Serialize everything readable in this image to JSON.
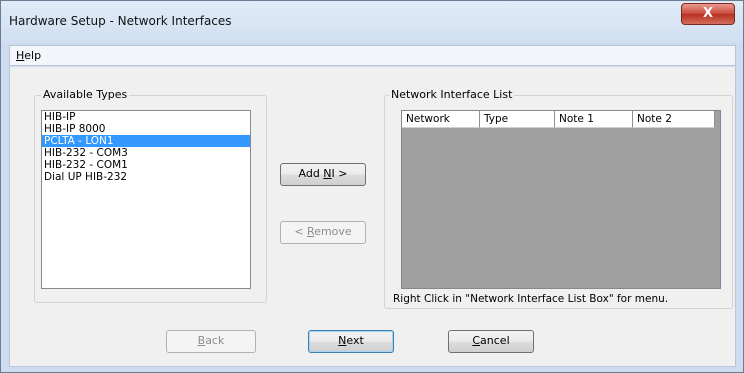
{
  "window": {
    "title": "Hardware Setup - Network Interfaces",
    "close_label": "X"
  },
  "menu": {
    "help": {
      "label_u": "H",
      "label_rest": "elp"
    }
  },
  "available_types": {
    "label": "Available Types",
    "items": [
      "HIB-IP",
      "HIB-IP 8000",
      "PCLTA - LON1",
      "HIB-232 - COM3",
      "HIB-232 - COM1",
      "Dial UP HIB-232"
    ],
    "selected_index": 2
  },
  "buttons": {
    "add_ni": {
      "pre": "Add ",
      "u": "N",
      "post": "I >"
    },
    "remove": {
      "pre": "< ",
      "u": "R",
      "post": "emove"
    },
    "back": {
      "pre": "",
      "u": "B",
      "post": "ack"
    },
    "next": {
      "pre": "",
      "u": "N",
      "post": "ext"
    },
    "cancel": {
      "pre": "",
      "u": "C",
      "post": "ancel"
    }
  },
  "network_list": {
    "label": "Network Interface List",
    "columns": [
      "Network",
      "Type",
      "Note 1",
      "Note 2"
    ],
    "hint": "Right Click in \"Network Interface List Box\" for menu."
  },
  "colors": {
    "selection": "#3399ff",
    "list_empty_bg": "#a0a0a0",
    "close_button": "#c8483a"
  }
}
